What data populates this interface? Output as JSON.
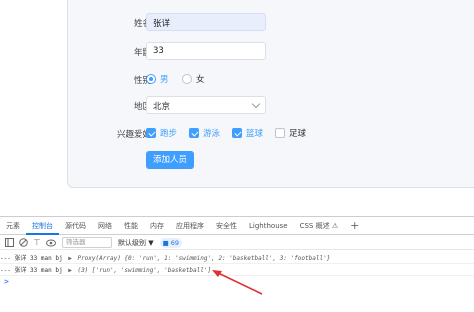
{
  "form": {
    "name_label": "姓名",
    "name_value": "张详",
    "age_label": "年龄",
    "age_value": "33",
    "gender_label": "性别",
    "gender_male": "男",
    "gender_female": "女",
    "region_label": "地区",
    "region_value": "北京",
    "hobby_label": "兴趣爱好",
    "hobbies": [
      {
        "label": "跑步",
        "checked": true
      },
      {
        "label": "游泳",
        "checked": true
      },
      {
        "label": "篮球",
        "checked": true
      },
      {
        "label": "足球",
        "checked": false
      }
    ],
    "submit_label": "添加人员"
  },
  "devtools": {
    "tabs": [
      "元素",
      "控制台",
      "源代码",
      "网络",
      "性能",
      "内存",
      "应用程序",
      "安全性",
      "Lighthouse",
      "CSS 概述 ⚠",
      "+"
    ],
    "active_tab": "控制台",
    "filter_placeholder": "筛选器",
    "level_label": "默认级别 ▼",
    "message_count": "69",
    "logs": [
      {
        "prefix": "--- 张详 33 man bj",
        "arrow": "▶",
        "text": "Proxy(Array) {0: 'run', 1: 'swimming', 2: 'basketball', 3: 'football'}"
      },
      {
        "prefix": "--- 张详 33 man bj",
        "arrow": "▶",
        "text": "(3) ['run', 'swimming', 'basketball']"
      }
    ],
    "prompt": ">"
  },
  "colors": {
    "accent": "#409eff",
    "annotation": "#e03030"
  }
}
